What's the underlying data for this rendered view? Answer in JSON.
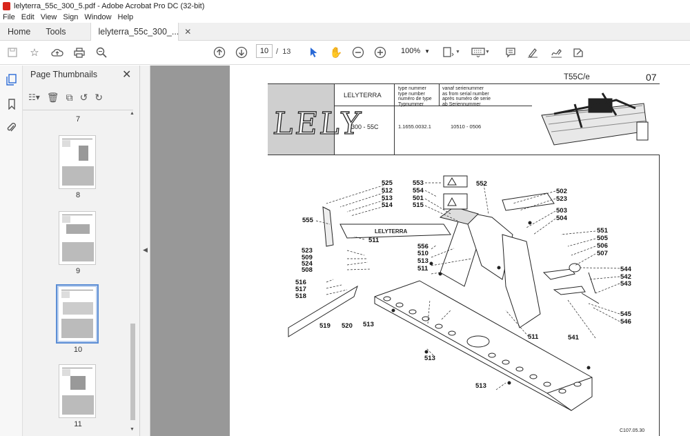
{
  "window": {
    "title": "lelyterra_55c_300_5.pdf - Adobe Acrobat Pro DC (32-bit)"
  },
  "menu": [
    "File",
    "Edit",
    "View",
    "Sign",
    "Window",
    "Help"
  ],
  "tabs": {
    "home": "Home",
    "tools": "Tools",
    "document": "lelyterra_55c_300_..."
  },
  "toolbar": {
    "current_page": "10",
    "page_separator": "/",
    "total_pages": "13",
    "zoom": "100%"
  },
  "panel": {
    "title": "Page Thumbnails"
  },
  "thumbnails": [
    {
      "label": "7"
    },
    {
      "label": "8"
    },
    {
      "label": "9"
    },
    {
      "label": "10",
      "selected": true
    },
    {
      "label": "11"
    }
  ],
  "document": {
    "code": "T55C/e",
    "page_no": "07",
    "logo_text": "LELY",
    "product": "LELYTERRA",
    "type_label": [
      "type nummer",
      "type number",
      "numéro de type",
      "Typnummer"
    ],
    "serial_label": [
      "vanaf serienummer",
      "as from serial number",
      "après numéro de serie",
      "ab Seriennummer"
    ],
    "model": "300 - 55C",
    "type_number": "1.1655.0032.1",
    "serial_range": "10510 - 0506",
    "footer_code": "C107.05.30",
    "part_labels": [
      "525",
      "512",
      "513",
      "514",
      "555",
      "511",
      "553",
      "554",
      "501",
      "515",
      "552",
      "502",
      "523",
      "503",
      "504",
      "551",
      "505",
      "506",
      "507",
      "544",
      "542",
      "543",
      "545",
      "546",
      "541",
      "511",
      "513",
      "513",
      "556",
      "510",
      "513",
      "511",
      "523",
      "509",
      "524",
      "508",
      "516",
      "517",
      "518",
      "519",
      "520",
      "513"
    ],
    "beam_text": "LELYTERRA"
  },
  "colors": {
    "accent": "#2a6ad6",
    "viewer_bg": "#989898",
    "pdf_red": "#d8261c"
  }
}
